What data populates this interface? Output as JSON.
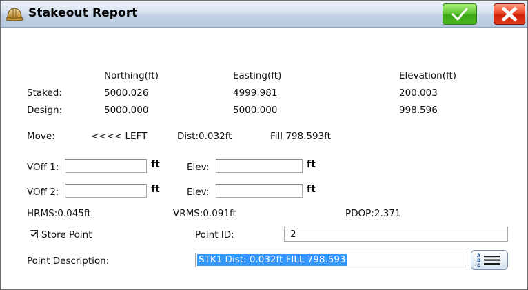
{
  "window": {
    "title": "Stakeout Report",
    "icon": "hardhat-icon",
    "ok_icon": "check-icon",
    "cancel_icon": "close-x-icon"
  },
  "table": {
    "headers": {
      "northing": "Northing(ft)",
      "easting": "Easting(ft)",
      "elevation": "Elevation(ft)"
    },
    "rows": [
      {
        "label": "Staked:",
        "northing": "5000.026",
        "easting": "4999.981",
        "elevation": "200.003"
      },
      {
        "label": "Design:",
        "northing": "5000.000",
        "easting": "5000.000",
        "elevation": "998.596"
      }
    ]
  },
  "move": {
    "label": "Move:",
    "direction": "<<<< LEFT",
    "dist": "Dist:0.032ft",
    "fill": "Fill 798.593ft"
  },
  "offsets": [
    {
      "voff_label": "VOff 1:",
      "voff_value": "",
      "unit": "ft",
      "elev_label": "Elev:",
      "elev_value": "",
      "elev_unit": "ft"
    },
    {
      "voff_label": "VOff 2:",
      "voff_value": "",
      "unit": "ft",
      "elev_label": "Elev:",
      "elev_value": "",
      "elev_unit": "ft"
    }
  ],
  "quality": {
    "hrms": "HRMS:0.045ft",
    "vrms": "VRMS:0.091ft",
    "pdop": "PDOP:2.371"
  },
  "store_point": {
    "label": "Store Point",
    "checked": true
  },
  "point_id": {
    "label": "Point ID:",
    "value": "2"
  },
  "point_description": {
    "label": "Point Description:",
    "value": "STK1 Dist: 0.032ft FILL 798.593",
    "list_button_icon": "abc-list-icon"
  },
  "colors": {
    "ok_green": "#4cba22",
    "cancel_red": "#e03a18",
    "selection_blue": "#3399ff"
  }
}
